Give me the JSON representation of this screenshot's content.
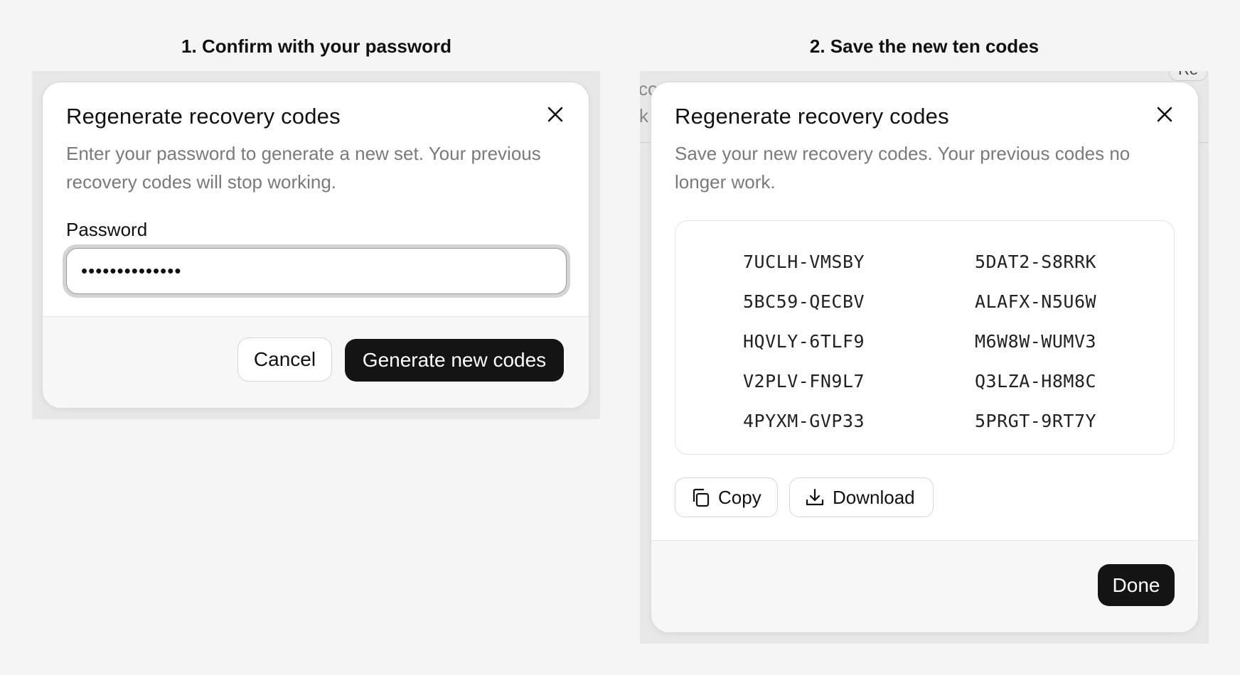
{
  "steps": [
    {
      "heading": "1. Confirm with your password",
      "dialog": {
        "title": "Regenerate recovery codes",
        "description": "Enter your password to generate a new set. Your previous recovery codes will stop working.",
        "password_label": "Password",
        "password_value": "••••••••••••••",
        "cancel_label": "Cancel",
        "confirm_label": "Generate new codes"
      }
    },
    {
      "heading": "2. Save the new ten codes",
      "background_fragments": [
        "co",
        "k",
        "Re"
      ],
      "dialog": {
        "title": "Regenerate recovery codes",
        "description": "Save your new recovery codes. Your previous codes no longer work.",
        "codes": [
          "7UCLH-VMSBY",
          "5DAT2-S8RRK",
          "5BC59-QECBV",
          "ALAFX-N5U6W",
          "HQVLY-6TLF9",
          "M6W8W-WUMV3",
          "V2PLV-FN9L7",
          "Q3LZA-H8M8C",
          "4PYXM-GVP33",
          "5PRGT-9RT7Y"
        ],
        "copy_label": "Copy",
        "download_label": "Download",
        "done_label": "Done"
      }
    }
  ],
  "icons": {
    "close": "close-icon",
    "copy": "copy-icon",
    "download": "download-icon"
  }
}
